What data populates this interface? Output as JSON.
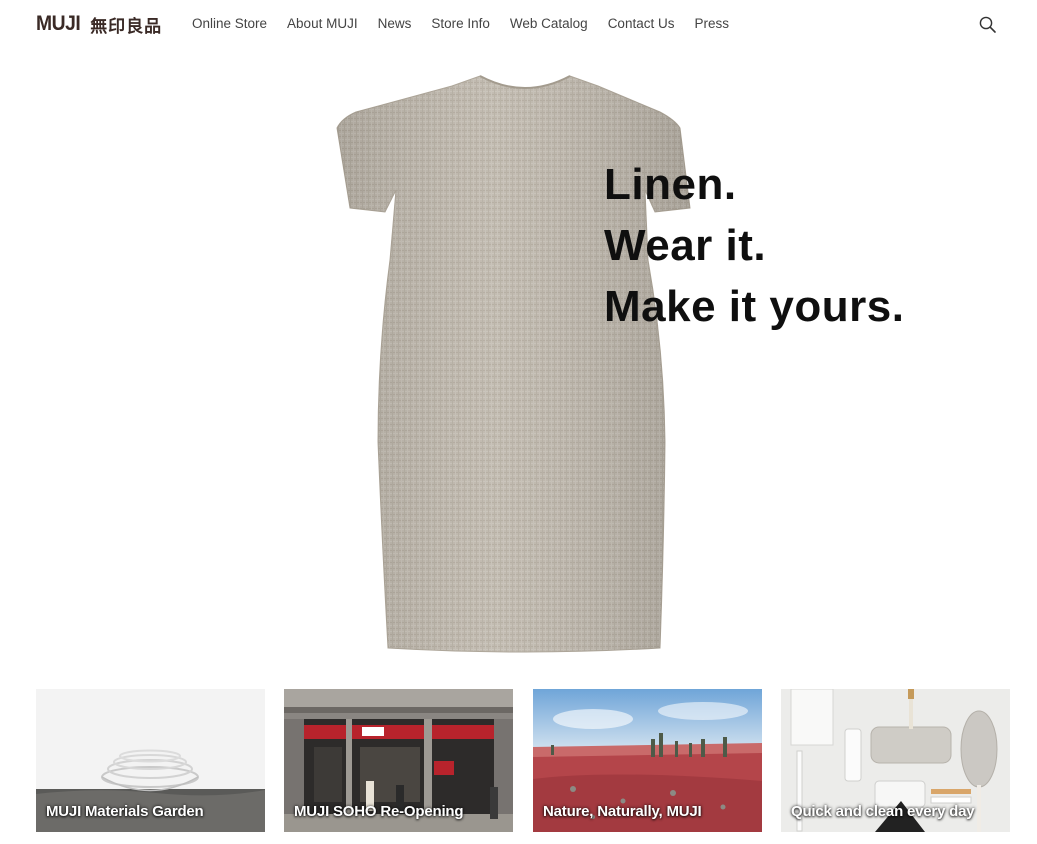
{
  "header": {
    "logo_text": "MUJI",
    "logo_kanji": "無印良品",
    "nav": [
      {
        "label": "Online Store"
      },
      {
        "label": "About MUJI"
      },
      {
        "label": "News"
      },
      {
        "label": "Store Info"
      },
      {
        "label": "Web Catalog"
      },
      {
        "label": "Contact Us"
      },
      {
        "label": "Press"
      }
    ],
    "search_icon": "search-icon"
  },
  "hero": {
    "line1": "Linen.",
    "line2": "Wear it.",
    "line3": "Make it yours.",
    "image": "linen-dress"
  },
  "cards": [
    {
      "label": "MUJI Materials Garden",
      "image": "glass-bowls"
    },
    {
      "label": "MUJI SOHO Re-Opening",
      "image": "store-front"
    },
    {
      "label": "Nature, Naturally, MUJI",
      "image": "red-landscape-cacti"
    },
    {
      "label": "Quick and clean every day",
      "image": "cleaning-tools"
    }
  ],
  "colors": {
    "brand": "#3a2a26",
    "nav_text": "#444444",
    "headline": "#0f0f0f",
    "linen": "#bdb6ab"
  }
}
